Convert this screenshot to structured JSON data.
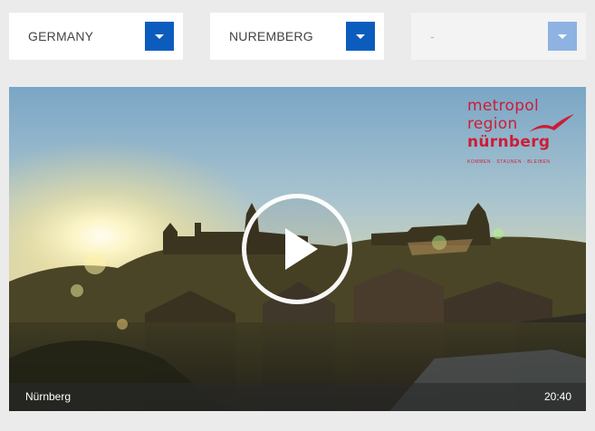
{
  "filters": {
    "country": {
      "label": "GERMANY"
    },
    "city": {
      "label": "NUREMBERG"
    },
    "camera": {
      "label": "-"
    }
  },
  "webcam": {
    "logo": {
      "line1": "metropol",
      "line2": "region",
      "line3": "nürnberg",
      "tagline": "KOMMEN · STAUNEN · BLEIBEN"
    },
    "location": "Nürnberg",
    "time": "20:40"
  },
  "colors": {
    "accent": "#0c5cbd",
    "accent_disabled": "#8eb3e3",
    "logo_red": "#cc1d37",
    "page_bg": "#ebebeb"
  },
  "icons": {
    "dropdown": "chevron-down-icon",
    "play": "play-icon"
  }
}
